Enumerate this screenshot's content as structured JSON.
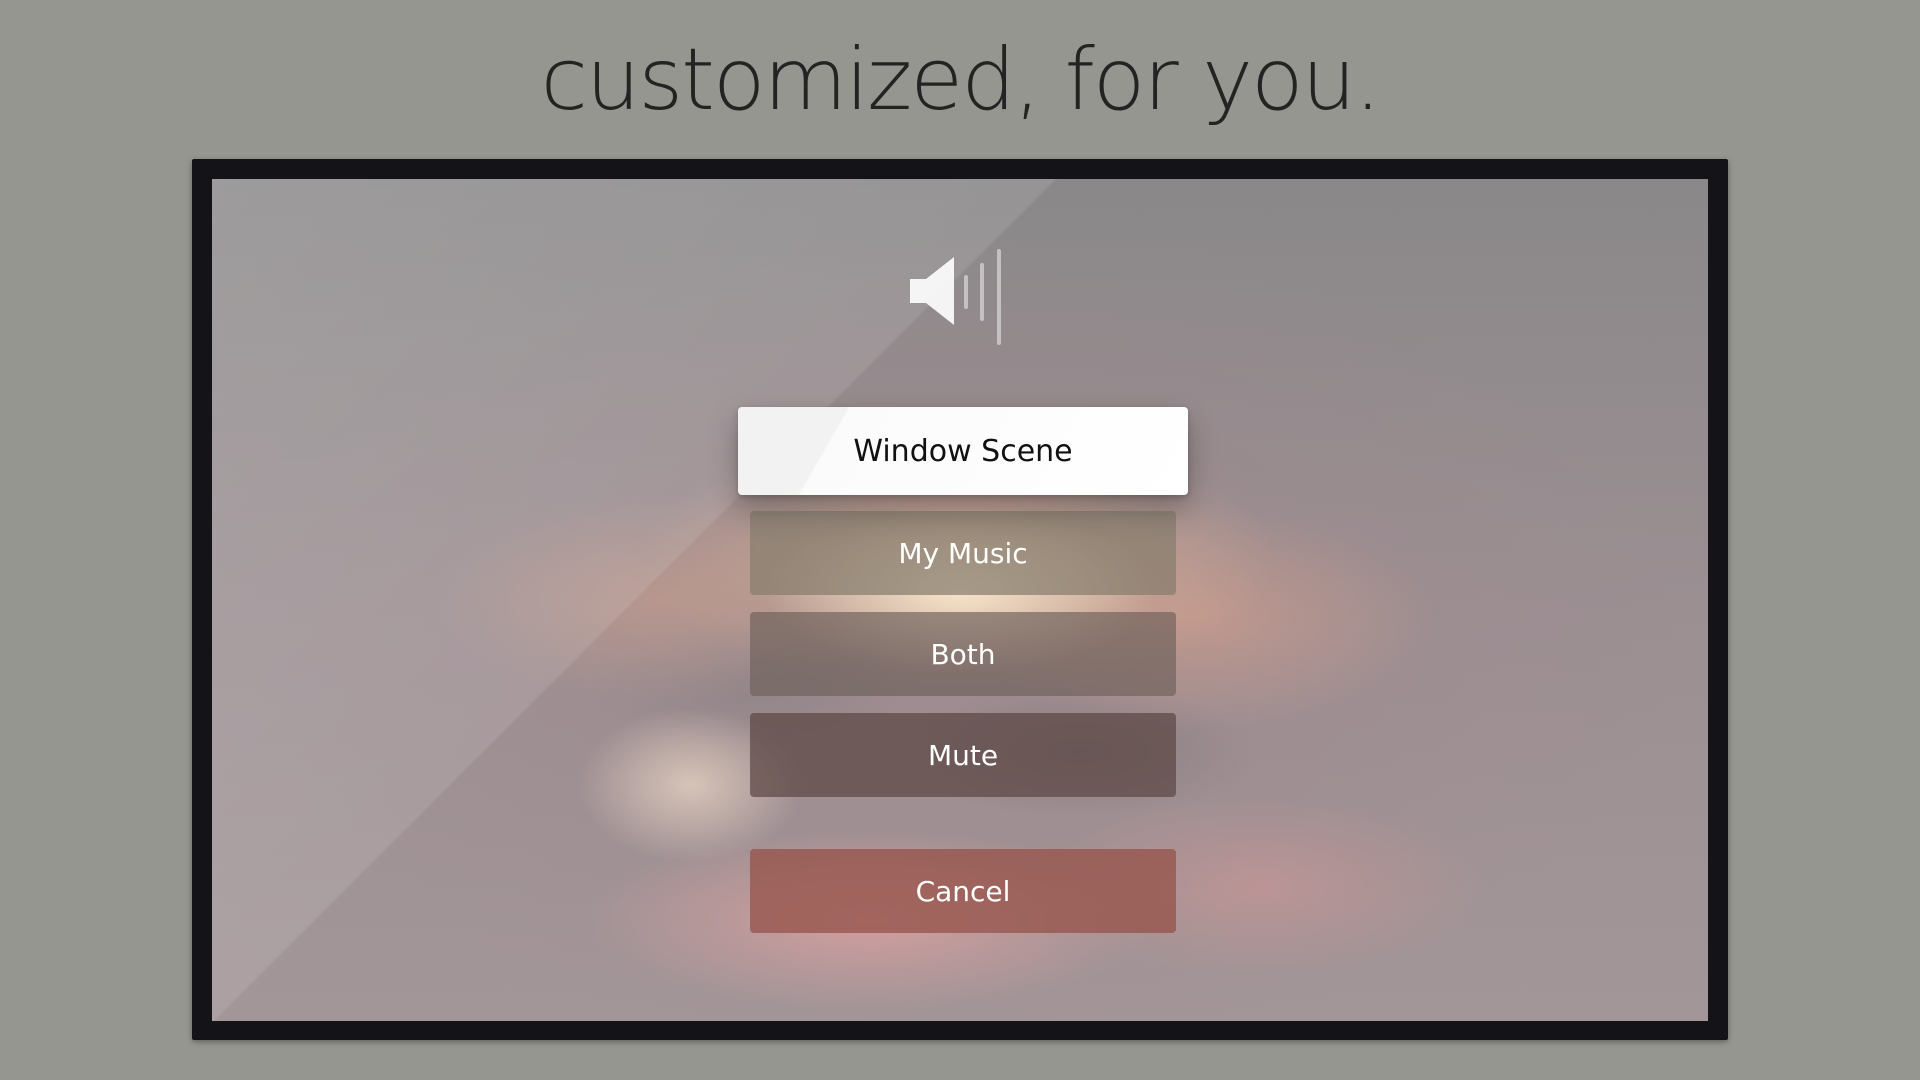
{
  "headline": "customized, for you.",
  "speaker_icon": "speaker-volume-icon",
  "menu": {
    "focused_option": "Window Scene",
    "options": [
      "My Music",
      "Both",
      "Mute"
    ],
    "cancel_label": "Cancel"
  },
  "colors": {
    "page_background": "#959690",
    "tv_bezel": "#141318",
    "focused_button_bg": "#ffffff",
    "focused_button_text": "#111111",
    "button_text": "#ffffff"
  }
}
